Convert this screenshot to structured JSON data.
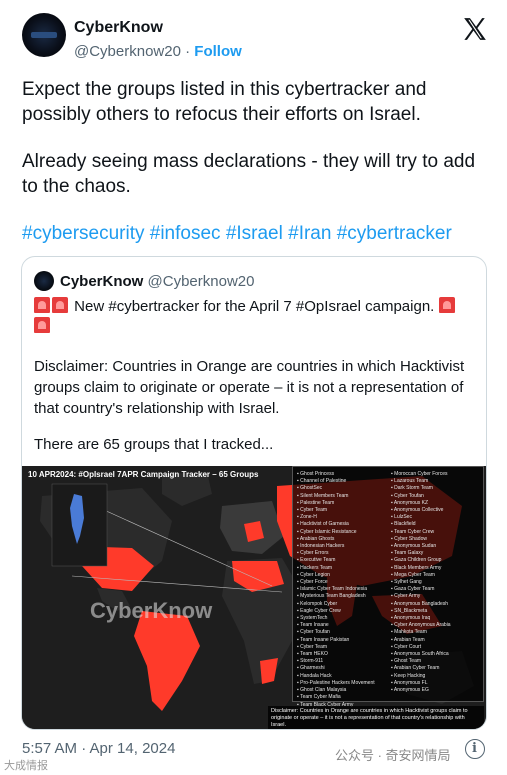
{
  "author": {
    "display_name": "CyberKnow",
    "handle": "@Cyberknow20",
    "separator": "·",
    "follow_label": "Follow"
  },
  "tweet": {
    "paragraph1": "Expect the groups listed in this cybertracker and possibly others to refocus their efforts on Israel.",
    "paragraph2": "Already seeing mass declarations - they will try to add to the chaos.",
    "hashtags": "#cybersecurity #infosec #Israel #Iran #cybertracker"
  },
  "quote": {
    "display_name": "CyberKnow",
    "handle": "@Cyberknow20",
    "line1": "New #cybertracker for the April 7 #OpIsrael campaign.",
    "disclaimer": "Disclaimer: Countries in Orange are countries in which Hacktivist groups claim to originate or operate – it is not a representation of that country's relationship with Israel.",
    "tracked": "There are 65 groups that I tracked...",
    "image": {
      "banner": "10 APR2024: #OpIsrael 7APR Campaign Tracker – 65 Groups",
      "watermark": "CyberKnow",
      "disclaimer": "Disclaimer: Countries in Orange are countries in which Hacktivist groups claim to originate or operate – it is not a representation of that country's relationship with Israel.",
      "groups_left": [
        "Ghost Princess",
        "Channel of Palestine",
        "GhostSec",
        "Silent Members Team",
        "Palestine Team",
        "Cyber Team",
        "Zone-H",
        "Hacktivist of Garnesia",
        "Cyber Islamic Resistance",
        "Arabian Ghosts",
        "Indonesian Hackers",
        "Cyber Errors",
        "Executive Team",
        "Hackers Team",
        "Cyber Legion",
        "Cyber Force",
        "Islamic Cyber Team Indonesia",
        "Mysterious Team Bangladesh",
        "Kelompok Cyber",
        "Eagle Cyber Crew",
        "SystemTech",
        "Team Insane",
        "Cyber Toufan",
        "Team Insane Pakistan",
        "Cyber Team",
        "Team HEKO",
        "Storm-911",
        "Gharmeshi",
        "Handala Hack",
        "Pro-Palestine Hackers Movement",
        "Ghost Clan Malaysia",
        "Team Cyber Mafia",
        "Team Black Cyber Army"
      ],
      "groups_right": [
        "Moroccan Cyber Forces",
        "Lazarous Team",
        "Dark Storm Team",
        "Cyber Toufan",
        "Anonymous KZ",
        "Anonymous Collective",
        "LulzSec",
        "Blackfield",
        "Team Cyber Crew",
        "Cyber Shadow",
        "Anonymous Sudan",
        "Team Galaxy",
        "Gaza Children Group",
        "Black Members Army",
        "Mega Cyber Team",
        "Sylhet Gang",
        "Gaza Cyber Team",
        "Cyber Army",
        "Anonymous Bangladesh",
        "SN_Blackmeta",
        "Anonymous Iraq",
        "Cyber Anonymous Arabia",
        "Mahkota Team",
        "Arabian Team",
        "Cyber Court",
        "Anonymous South Africa",
        "Ghost Team",
        "Arabian Cyber Team",
        "Keep Hacking",
        "Anonymous FL",
        "Anonymous EG"
      ]
    }
  },
  "timestamp": "5:57 AM · Apr 14, 2024",
  "watermarks": {
    "wechat": "公众号 · 奇安网情局",
    "corner": "大成情报"
  }
}
